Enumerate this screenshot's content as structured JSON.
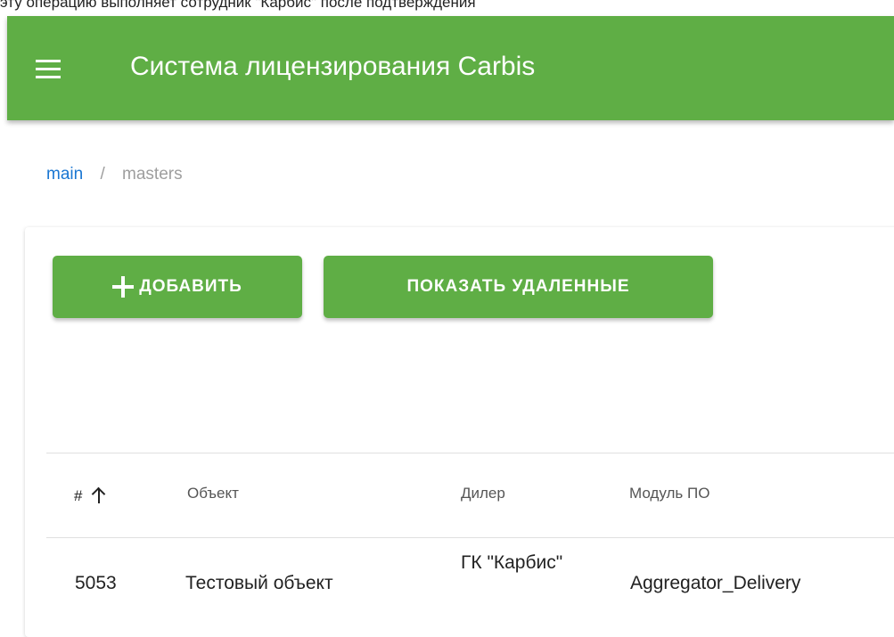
{
  "top_caption": "эту операцию выполняет сотрудник \"Карбис\" после подтверждения",
  "app_bar": {
    "title": "Система лицензирования Carbis",
    "menu_icon": "menu-icon",
    "color": "#5fae45"
  },
  "breadcrumb": {
    "items": [
      "main",
      "masters"
    ],
    "separator": "/"
  },
  "toolbar": {
    "add_label": "ДОБАВИТЬ",
    "show_deleted_label": "ПОКАЗАТЬ УДАЛЕННЫЕ"
  },
  "table": {
    "columns": [
      "#",
      "Объект",
      "Дилер",
      "Модуль ПО"
    ],
    "sort": {
      "column": "#",
      "direction": "asc"
    },
    "rows": [
      {
        "id": "5053",
        "object": "Тестовый объект",
        "dealer": "ГК \"Карбис\"",
        "module": "Aggregator_Delivery"
      }
    ]
  }
}
